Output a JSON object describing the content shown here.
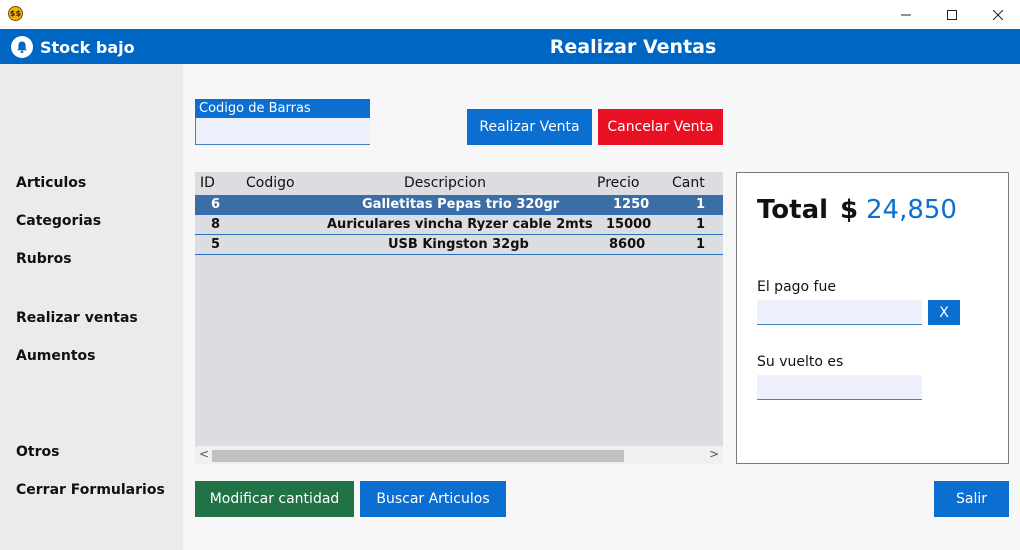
{
  "window": {
    "app_icon": "app-logo-icon",
    "controls": {
      "minimize": "—",
      "maximize": "☐",
      "close": "✕"
    }
  },
  "header": {
    "alert_label": "Stock bajo",
    "alert_icon": "bell-icon",
    "title": "Realizar Ventas",
    "color": "#0066c4"
  },
  "sidebar": {
    "items": [
      {
        "label": "Articulos"
      },
      {
        "label": "Categorias"
      },
      {
        "label": "Rubros"
      },
      {
        "label": "Realizar ventas"
      },
      {
        "label": "Aumentos"
      },
      {
        "label": "Otros"
      },
      {
        "label": "Cerrar Formularios"
      }
    ]
  },
  "barcode": {
    "label": "Codigo de Barras",
    "value": ""
  },
  "actions": {
    "sell": "Realizar Venta",
    "cancel": "Cancelar Venta",
    "modify": "Modificar cantidad",
    "search": "Buscar Articulos",
    "exit": "Salir"
  },
  "table": {
    "columns": [
      "ID",
      "Codigo",
      "Descripcion",
      "Precio",
      "Cant"
    ],
    "rows": [
      {
        "id": "6",
        "codigo": "",
        "descripcion": "Galletitas Pepas trio 320gr",
        "precio": "1250",
        "cant": "1",
        "selected": true
      },
      {
        "id": "8",
        "codigo": "",
        "descripcion": "Auriculares vincha Ryzer cable 2mts",
        "precio": "15000",
        "cant": "1",
        "selected": false
      },
      {
        "id": "5",
        "codigo": "",
        "descripcion": "USB Kingston 32gb",
        "precio": "8600",
        "cant": "1",
        "selected": false
      }
    ],
    "scroll_left": "<",
    "scroll_right": ">"
  },
  "summary": {
    "total_label": "Total",
    "currency": "$",
    "total_value": "24,850",
    "pay_label": "El pago fue",
    "pay_value": "",
    "clear_label": "X",
    "change_label": "Su vuelto es",
    "change_value": ""
  },
  "colors": {
    "accent": "#0a6fd1",
    "danger": "#e81123",
    "success": "#217346",
    "selected_row": "#3a6ea5"
  }
}
